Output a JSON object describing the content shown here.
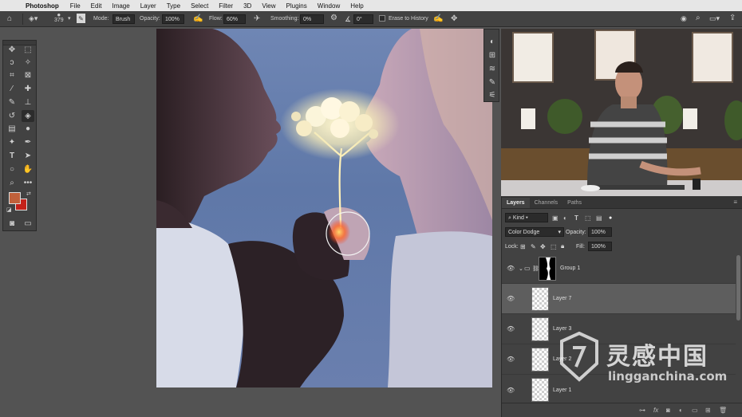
{
  "menubar": {
    "app": "Photoshop",
    "items": [
      "File",
      "Edit",
      "Image",
      "Layer",
      "Type",
      "Select",
      "Filter",
      "3D",
      "View",
      "Plugins",
      "Window",
      "Help"
    ]
  },
  "options": {
    "brush_size": "379",
    "mode_label": "Mode:",
    "mode_value": "Brush",
    "opacity_label": "Opacity:",
    "opacity_value": "100%",
    "flow_label": "Flow:",
    "flow_value": "60%",
    "smoothing_label": "Smoothing:",
    "smoothing_value": "0%",
    "angle_value": "0°",
    "erase_history_label": "Erase to History"
  },
  "colors": {
    "foreground": "#c0603a",
    "background": "#c4211a"
  },
  "layers_panel": {
    "tabs": [
      "Layers",
      "Channels",
      "Paths"
    ],
    "filter_label": "Kind",
    "blend_mode": "Color Dodge",
    "opacity_label": "Opacity:",
    "opacity_value": "100%",
    "lock_label": "Lock:",
    "fill_label": "Fill:",
    "fill_value": "100%",
    "layers": [
      {
        "name": "Group 1"
      },
      {
        "name": "Layer 7"
      },
      {
        "name": "Layer 3"
      },
      {
        "name": "Layer 2"
      },
      {
        "name": "Layer 1"
      }
    ]
  },
  "watermark": {
    "brand_cn": "灵感中国",
    "domain": "lingganchina.com"
  }
}
